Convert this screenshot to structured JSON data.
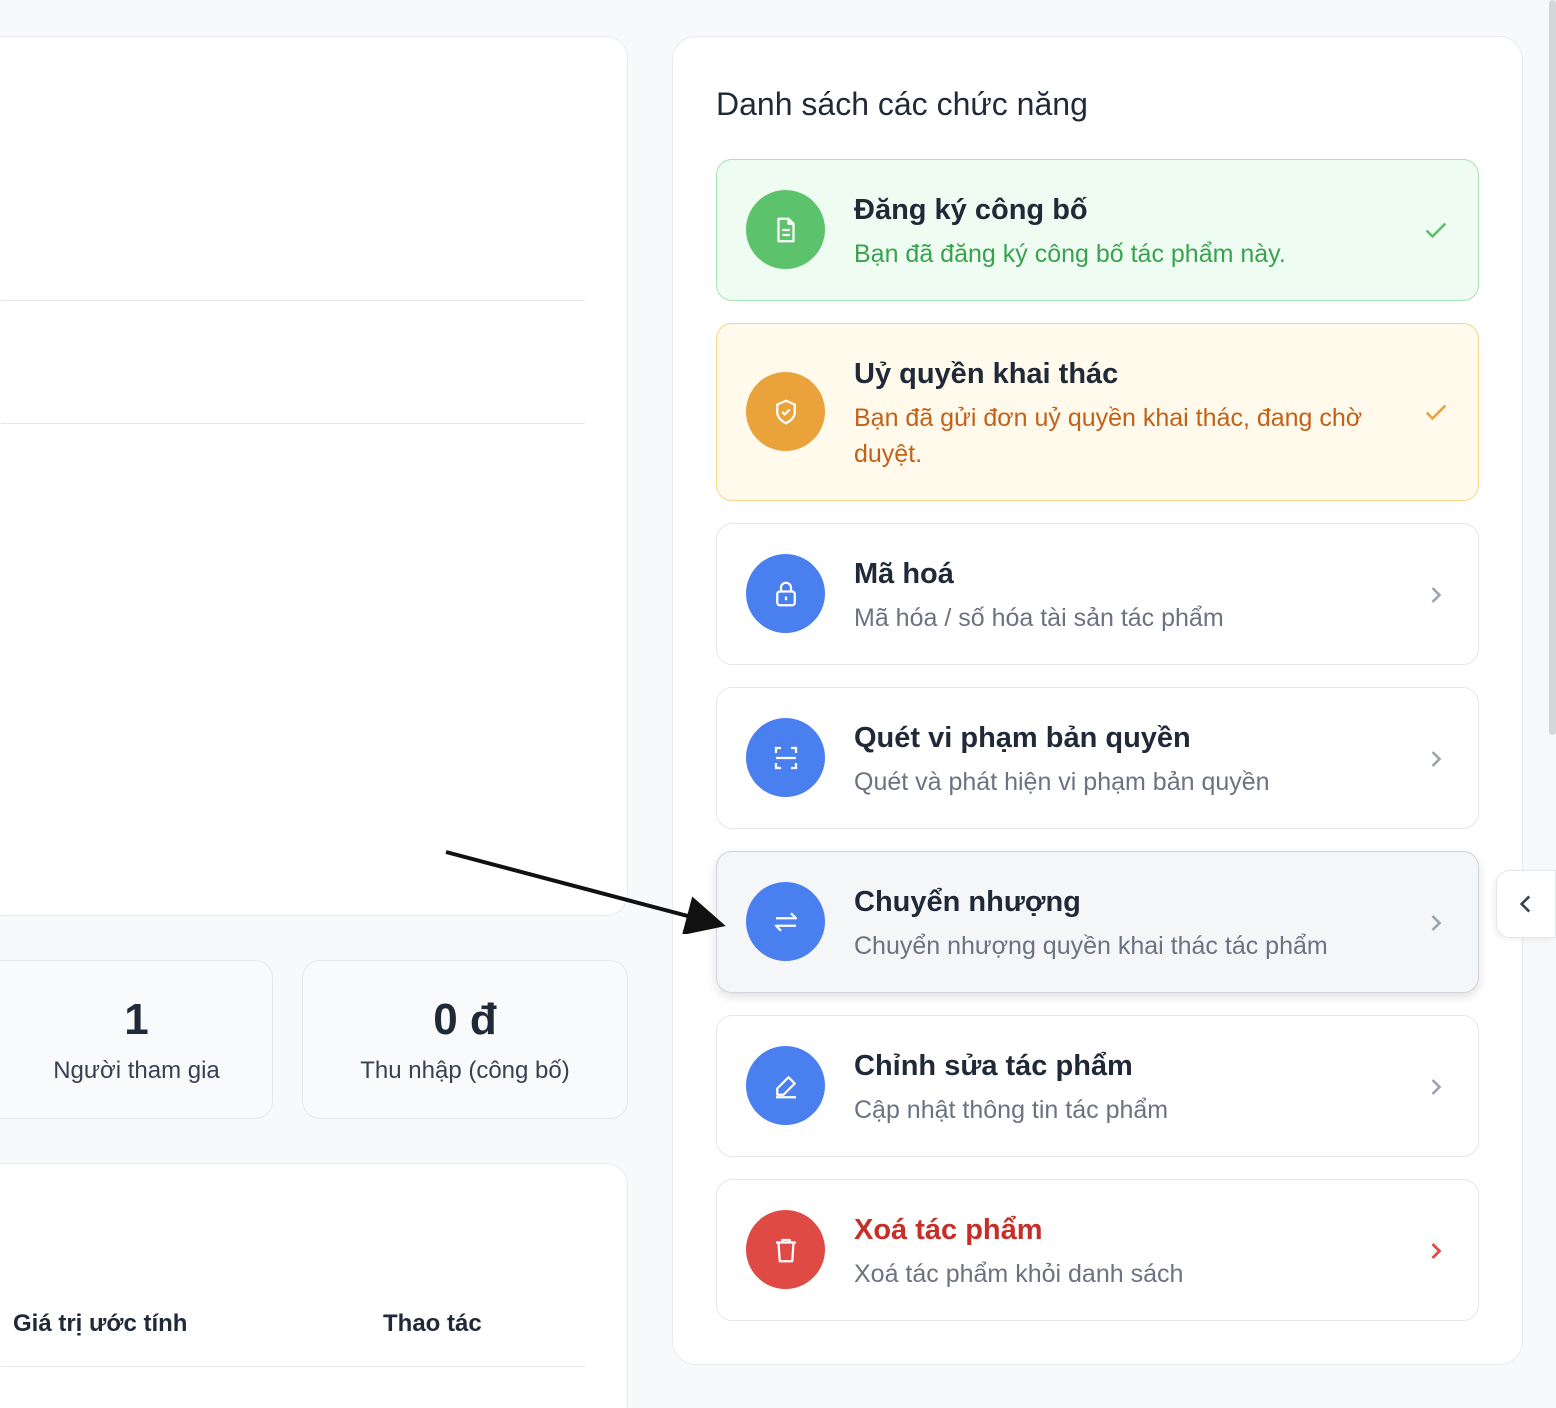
{
  "stats": [
    {
      "value": "1",
      "label": "Người tham gia"
    },
    {
      "value": "0 đ",
      "label": "Thu nhập (công bố)"
    }
  ],
  "table": {
    "headers": [
      "Giá trị ước tính",
      "Thao tác"
    ]
  },
  "panel": {
    "title": "Danh sách các chức năng",
    "features": [
      {
        "title": "Đăng ký công bố",
        "description": "Bạn đã đăng ký công bố tác phẩm này.",
        "icon": "document-icon",
        "status": "done",
        "color": "#5cc26b"
      },
      {
        "title": "Uỷ quyền khai thác",
        "description": "Bạn đã gửi đơn uỷ quyền khai thác, đang chờ duyệt.",
        "icon": "shield-check-icon",
        "status": "pending",
        "color": "#eaa23a"
      },
      {
        "title": "Mã hoá",
        "description": "Mã hóa / số hóa tài sản tác phẩm",
        "icon": "lock-icon",
        "status": "available",
        "color": "#4a7ff0"
      },
      {
        "title": "Quét vi phạm bản quyền",
        "description": "Quét và phát hiện vi phạm bản quyền",
        "icon": "scan-icon",
        "status": "available",
        "color": "#4a7ff0"
      },
      {
        "title": "Chuyển nhượng",
        "description": "Chuyển nhượng quyền khai thác tác phẩm",
        "icon": "transfer-icon",
        "status": "available",
        "color": "#4a7ff0"
      },
      {
        "title": "Chỉnh sửa tác phẩm",
        "description": "Cập nhật thông tin tác phẩm",
        "icon": "edit-icon",
        "status": "available",
        "color": "#4a7ff0"
      },
      {
        "title": "Xoá tác phẩm",
        "description": "Xoá tác phẩm khỏi danh sách",
        "icon": "trash-icon",
        "status": "danger",
        "color": "#e04a44"
      }
    ]
  },
  "colors": {
    "done_text": "#3aa24f",
    "pending_text": "#c2621a",
    "danger_text": "#c62f28",
    "chevron": "#9ca3af"
  }
}
